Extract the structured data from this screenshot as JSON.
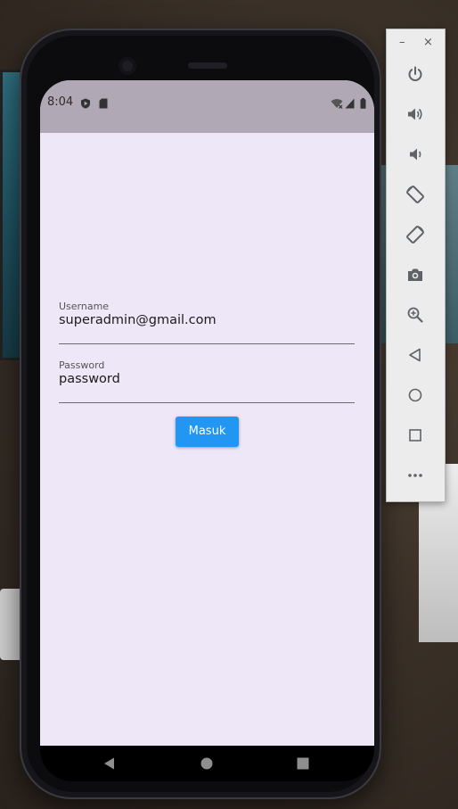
{
  "status_bar": {
    "time": "8:04"
  },
  "login_form": {
    "username": {
      "label": "Username",
      "value": "superadmin@gmail.com"
    },
    "password": {
      "label": "Password",
      "value": "password"
    },
    "submit_label": "Masuk"
  },
  "colors": {
    "screen_background": "#eee7f7",
    "status_bar": "#b0a8b4",
    "button_primary": "#2196f3",
    "nav_bar": "#000000"
  },
  "nav_bar": {
    "items": [
      "back-icon",
      "home-icon",
      "overview-icon"
    ]
  },
  "emulator_toolbar": {
    "window_controls": {
      "minimize": "–",
      "close": "×"
    },
    "buttons": [
      "power-icon",
      "volume-up-icon",
      "volume-down-icon",
      "rotate-left-icon",
      "rotate-right-icon",
      "camera-icon",
      "zoom-icon",
      "back-icon",
      "home-icon",
      "overview-icon",
      "more-icon"
    ]
  }
}
